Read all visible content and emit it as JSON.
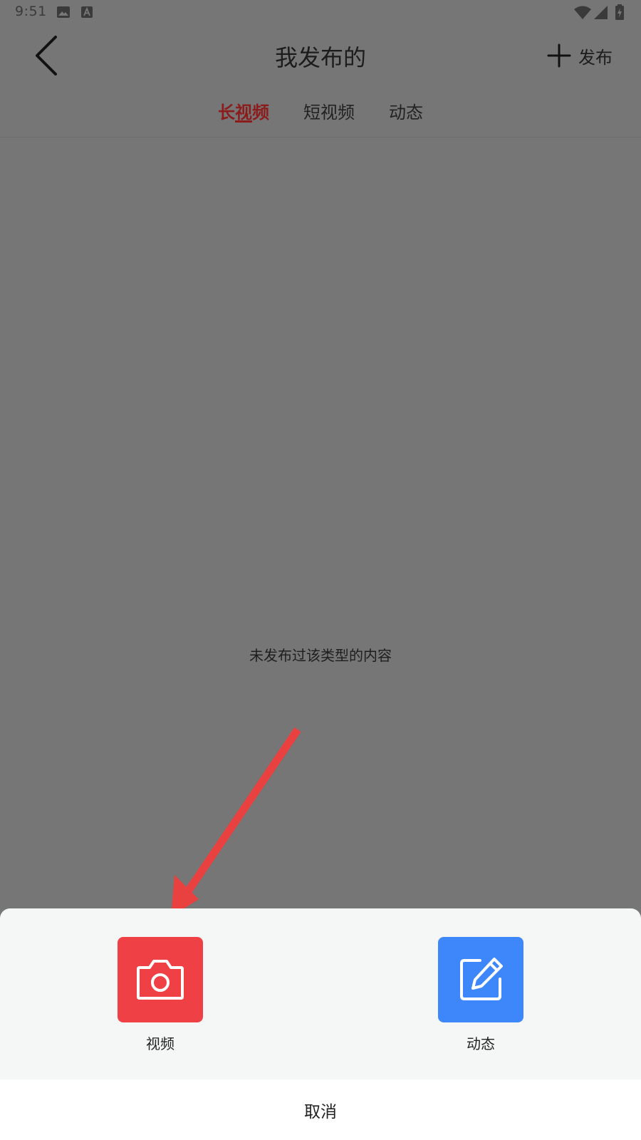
{
  "status_bar": {
    "time": "9:51",
    "icons": [
      "image-icon",
      "a-badge-icon",
      "wifi-icon",
      "signal-icon",
      "battery-icon"
    ]
  },
  "header": {
    "title": "我发布的",
    "back_icon": "chevron-left-icon",
    "publish_label": "发布",
    "publish_icon": "plus-icon"
  },
  "tabs": [
    {
      "label": "长视频",
      "active": true
    },
    {
      "label": "短视频",
      "active": false
    },
    {
      "label": "动态",
      "active": false
    }
  ],
  "empty_state": {
    "message": "未发布过该类型的内容"
  },
  "sheet": {
    "options": [
      {
        "label": "视频",
        "icon": "camera-icon",
        "color": "#ef4145"
      },
      {
        "label": "动态",
        "icon": "edit-icon",
        "color": "#3d87fb"
      }
    ],
    "cancel_label": "取消"
  },
  "colors": {
    "overlay_background": "#767676",
    "active_tab": "#8c1c1c",
    "annotation_arrow": "#e94040",
    "sheet_background": "#f5f6f6"
  }
}
